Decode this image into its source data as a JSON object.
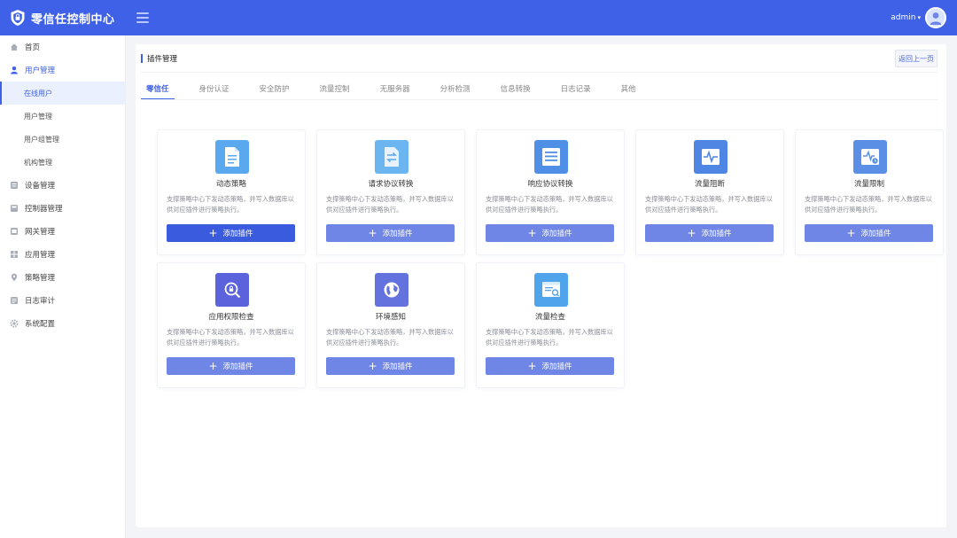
{
  "header": {
    "app_title": "零信任控制中心",
    "username": "admin",
    "caret": "▾",
    "logo_icon": "shield-icon",
    "avatar_icon": "user-avatar-icon"
  },
  "sidebar": {
    "items": [
      {
        "label": "首页",
        "icon": "home-icon"
      },
      {
        "label": "用户管理",
        "icon": "user-icon"
      },
      {
        "label": "设备管理",
        "icon": "device-icon"
      },
      {
        "label": "控制器管理",
        "icon": "controller-icon"
      },
      {
        "label": "网关管理",
        "icon": "gateway-icon"
      },
      {
        "label": "应用管理",
        "icon": "apps-icon"
      },
      {
        "label": "策略管理",
        "icon": "location-icon"
      },
      {
        "label": "日志审计",
        "icon": "log-icon"
      },
      {
        "label": "系统配置",
        "icon": "gear-icon"
      }
    ],
    "user_sub_items": [
      "在线用户",
      "用户管理",
      "用户组管理",
      "机构管理"
    ]
  },
  "main": {
    "page_title": "插件管理",
    "back_button": "返回上一页",
    "tabs": [
      "零信任",
      "身份认证",
      "安全防护",
      "流量控制",
      "无服务器",
      "分析检测",
      "信息转换",
      "日志记录",
      "其他"
    ],
    "cards": [
      {
        "name": "动态策略",
        "icon": "document-icon"
      },
      {
        "name": "请求协议转换",
        "icon": "swap-icon"
      },
      {
        "name": "响应协议转换",
        "icon": "list-icon"
      },
      {
        "name": "流量阻断",
        "icon": "pulse-icon"
      },
      {
        "name": "流量限制",
        "icon": "pulse-clock-icon"
      },
      {
        "name": "应用权限检查",
        "icon": "lock-search-icon"
      },
      {
        "name": "环境感知",
        "icon": "globe-icon"
      },
      {
        "name": "流量检查",
        "icon": "browser-search-icon"
      }
    ],
    "card_description": "支撑策略中心下发动态策略，并写入数据库以供对应插件进行策略执行。",
    "add_button_label": "添加插件",
    "add_button_plus": "+"
  },
  "colors": {
    "brand": "#3e61e8",
    "primary_button": "#3a5bde",
    "secondary_button": "#6f86e6",
    "icon_light_blue": "#5aa8ee",
    "icon_indigo": "#5a6fe0"
  }
}
